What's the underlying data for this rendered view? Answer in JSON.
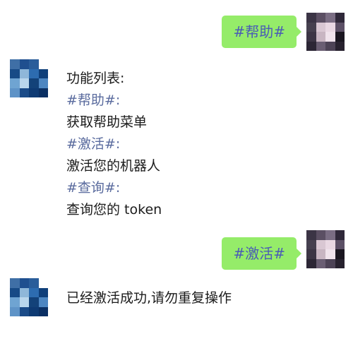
{
  "messages": [
    {
      "side": "outgoing",
      "text": "#帮助#"
    },
    {
      "side": "incoming",
      "lines": [
        "功能列表:",
        "#帮助#:",
        "获取帮助菜单",
        "#激活#:",
        "激活您的机器人",
        "#查询#:",
        "查询您的 token"
      ]
    },
    {
      "side": "outgoing",
      "text": "#激活#"
    },
    {
      "side": "incoming",
      "lines": [
        "已经激活成功,请勿重复操作"
      ]
    }
  ],
  "avatars": {
    "user": {
      "colors": [
        "#3b3445",
        "#5b4f63",
        "#7a6d83",
        "#2f2839",
        "#46404f",
        "#d9c7d3",
        "#e9d8e3",
        "#5c5066",
        "#3c3545",
        "#c8b5c2",
        "#f0e3ec",
        "#1a1620",
        "#2c2635",
        "#6a5e73",
        "#4d4356",
        "#27212e"
      ]
    },
    "bot": {
      "colors": [
        "#3f6fa6",
        "#1f4f8f",
        "#2a5d9a",
        "#ffffff",
        "#174a86",
        "#8fb7d9",
        "#2d6cb0",
        "#0f3f7a",
        "#6fa4d2",
        "#b9d6ec",
        "#134279",
        "#4d86c1",
        "#5e93c7",
        "#1b4b88",
        "#0e3a73",
        "#0a2f63"
      ]
    }
  }
}
